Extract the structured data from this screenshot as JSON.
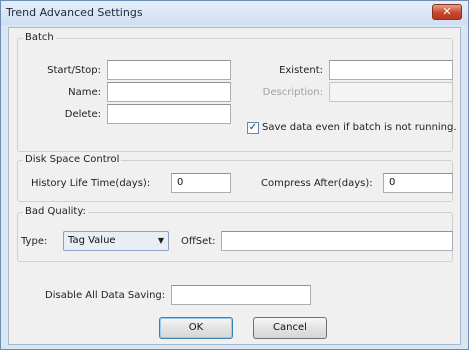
{
  "window": {
    "title": "Trend Advanced Settings",
    "close_glyph": "✕"
  },
  "batch": {
    "legend": "Batch",
    "start_stop_label": "Start/Stop:",
    "start_stop_value": "",
    "name_label": "Name:",
    "name_value": "",
    "delete_label": "Delete:",
    "delete_value": "",
    "existent_label": "Existent:",
    "existent_value": "",
    "description_label": "Description:",
    "description_value": "",
    "save_data_checked": true,
    "save_data_label": "Save data even if batch is not running."
  },
  "disk_space": {
    "legend": "Disk Space Control",
    "history_label": "History Life Time(days):",
    "history_value": "0",
    "compress_label": "Compress After(days):",
    "compress_value": "0"
  },
  "bad_quality": {
    "legend": "Bad Quality:",
    "type_label": "Type:",
    "type_value": "Tag Value",
    "offset_label": "OffSet:",
    "offset_value": ""
  },
  "disable_saving": {
    "label": "Disable All Data Saving:",
    "value": ""
  },
  "buttons": {
    "ok": "OK",
    "cancel": "Cancel"
  },
  "icons": {
    "checkmark": "✓",
    "dropdown_arrow": "▼"
  }
}
